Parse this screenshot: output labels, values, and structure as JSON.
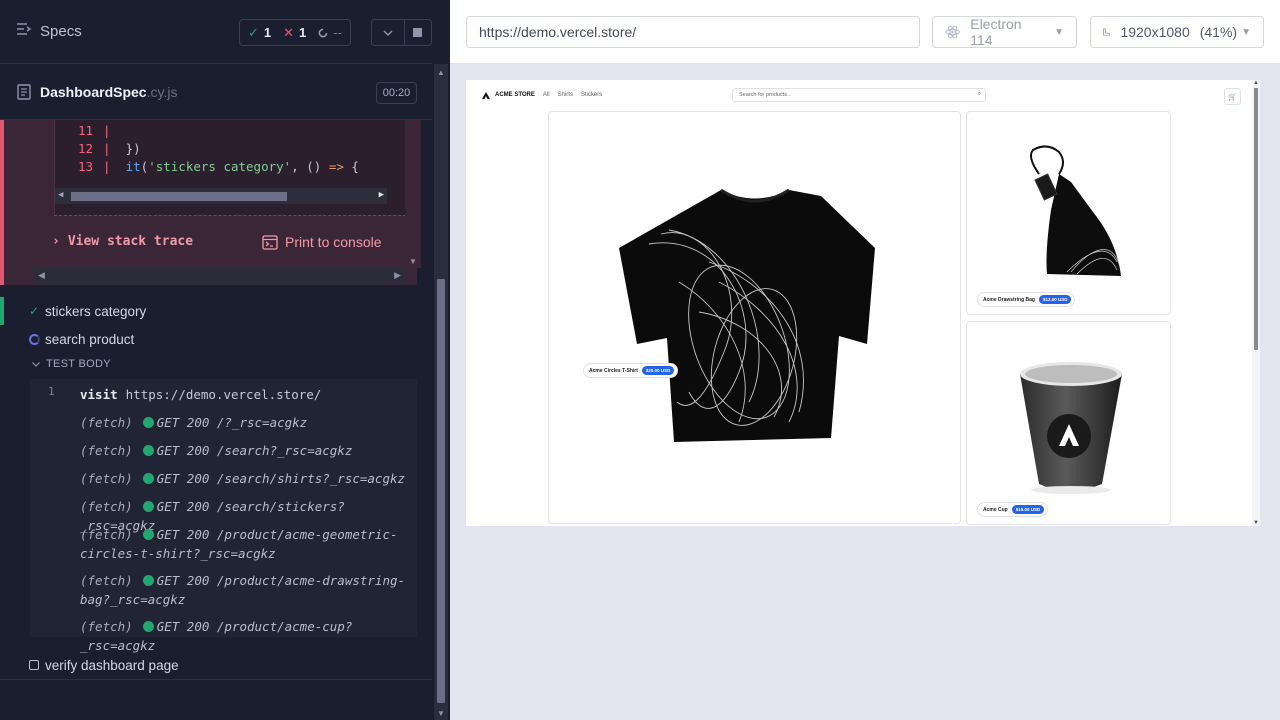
{
  "runner": {
    "specs_label": "Specs",
    "stats": {
      "passed": "1",
      "failed": "1",
      "pending": "--"
    },
    "spec": {
      "name": "DashboardSpec",
      "ext": ".cy.js",
      "duration": "00:20"
    },
    "code_frame": {
      "lines": [
        {
          "num": "11",
          "text": ""
        },
        {
          "num": "12",
          "text": "  })"
        },
        {
          "num": "13",
          "fn": "it",
          "paren_open": "(",
          "str": "'stickers category'",
          "mid": ", () ",
          "arrow": "=>",
          "end": " {"
        }
      ]
    },
    "view_stack_trace": "View stack trace",
    "print_to_console": "Print to console",
    "tests": {
      "stickers": "stickers category",
      "search": "search product",
      "verify": "verify dashboard page"
    },
    "test_body_label": "TEST BODY",
    "commands": {
      "visit": {
        "num": "1",
        "name": "visit",
        "url": "https://demo.vercel.store/"
      },
      "fetch": [
        {
          "kw": "(fetch)",
          "req": "GET 200 /?_rsc=acgkz"
        },
        {
          "kw": "(fetch)",
          "req": "GET 200 /search?_rsc=acgkz"
        },
        {
          "kw": "(fetch)",
          "req": "GET 200 /search/shirts?_rsc=acgkz"
        },
        {
          "kw": "(fetch)",
          "req": "GET 200 /search/stickers?_rsc=acgkz"
        },
        {
          "kw": "(fetch)",
          "req": "GET 200 /product/acme-geometric-circles-t-shirt?_rsc=acgkz"
        },
        {
          "kw": "(fetch)",
          "req": "GET 200 /product/acme-drawstring-bag?_rsc=acgkz"
        },
        {
          "kw": "(fetch)",
          "req": "GET 200 /product/acme-cup?_rsc=acgkz"
        }
      ]
    }
  },
  "aut": {
    "url": "https://demo.vercel.store/",
    "browser": "Electron 114",
    "viewport": "1920x1080",
    "zoom": "(41%)"
  },
  "store": {
    "logo_text": "ACME STORE",
    "nav": [
      "All",
      "Shirts",
      "Stickers"
    ],
    "search_placeholder": "Search for products...",
    "products": [
      {
        "name": "Acme Circles T-Shirt",
        "price": "$20.00 USD"
      },
      {
        "name": "Acme Drawstring Bag",
        "price": "$12.00 USD"
      },
      {
        "name": "Acme Cup",
        "price": "$15.00 USD"
      }
    ]
  },
  "colors": {
    "runner_bg": "#1b1e2e",
    "pass": "#1fa971",
    "fail": "#f4516c",
    "price_badge": "#2563eb"
  }
}
